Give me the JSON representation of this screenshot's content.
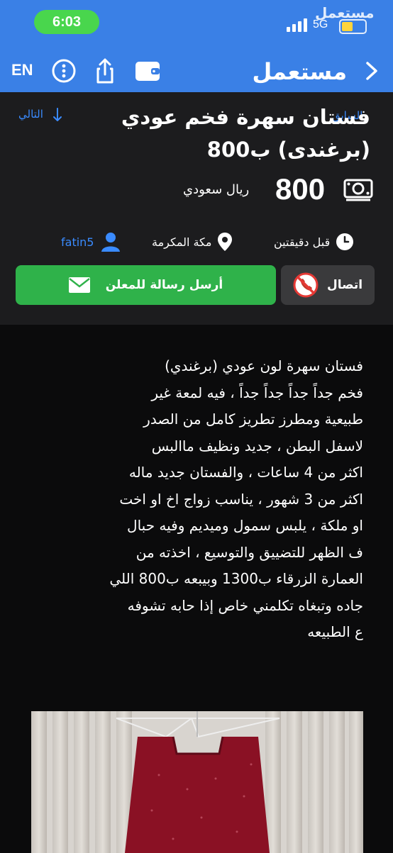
{
  "status_bar": {
    "time": "6:03",
    "network": "5G",
    "watermark": "مستعمل",
    "time_pill_color": "#49d64d",
    "battery_color": "#ffd43b"
  },
  "top_bar": {
    "language_button": "EN",
    "logo_text": "مستعمل",
    "icons": [
      "info-icon",
      "share-icon",
      "wallet-icon",
      "chevron-right-icon"
    ],
    "background_color": "#3a80e6"
  },
  "listing": {
    "next_label": "التالي",
    "prev_label": "السابق",
    "title": "فستان سهرة فخم عودي (برغندى) ب800",
    "price": {
      "amount": "800",
      "currency": "ريال سعودي"
    },
    "meta": {
      "time_ago": "قبل دقيقتين",
      "location": "مكة المكرمة",
      "username": "fatin5"
    },
    "actions": {
      "message_button": "أرسل رسالة للمعلن",
      "call_button": "اتصال"
    },
    "description_lines": [
      "فستان سهرة لون عودي (برغندي)",
      "فخم جداً جداً جداً جداً ، فيه لمعة غير",
      "طبيعية ومطرز تطريز كامل من الصدر",
      "لاسفل البطن ، جديد ونظيف ماالبس",
      "اكثر من 4 ساعات ، والفستان جديد ماله",
      "اكثر من 3 شهور ، يناسب زواج اخ او اخت",
      "او ملكة ، يلبس سمول وميديم وفيه حبال",
      "ف الظهر للتضييق والتوسيع ، اخذته من",
      "العمارة الزرقاء ب1300 وبيبعه ب800 اللي",
      "جاده وتبغاه تكلمني خاص إذا حابه تشوفه",
      "ع الطبيعه"
    ]
  },
  "colors": {
    "accent_blue": "#3a8bff",
    "message_button": "#2fb24a",
    "call_button": "#3a3a3c",
    "panel": "#1c1c1e",
    "dress": "#8a1124"
  }
}
